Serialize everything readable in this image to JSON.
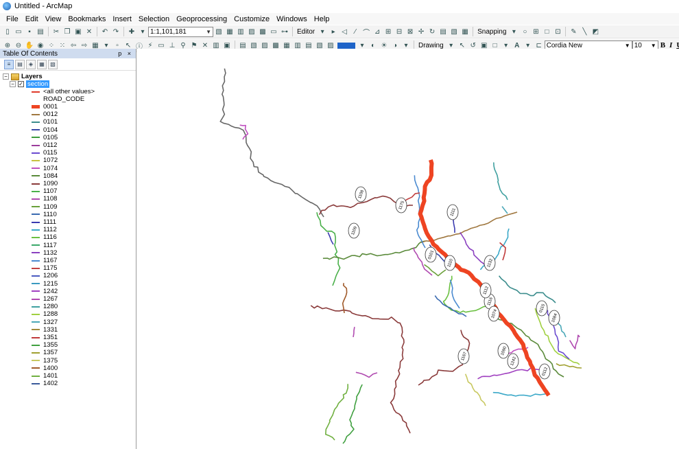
{
  "window": {
    "title": "Untitled - ArcMap"
  },
  "menu": [
    "File",
    "Edit",
    "View",
    "Bookmarks",
    "Insert",
    "Selection",
    "Geoprocessing",
    "Customize",
    "Windows",
    "Help"
  ],
  "toolbar": {
    "scale": "1:1,101,181",
    "editor_label": "Editor",
    "snapping_label": "Snapping",
    "drawing_label": "Drawing",
    "font_name": "Cordia New",
    "font_size": "10",
    "bold": "B",
    "italic": "I",
    "underline": "U",
    "font_color_glyph": "A"
  },
  "toc": {
    "title": "Table Of Contents",
    "controls": "p ×",
    "root_label": "Layers",
    "layer_name": "section",
    "other_values": "<all other values>",
    "field_name": "ROAD_CODE",
    "items": [
      {
        "code": "0001",
        "color": "#ee4422"
      },
      {
        "code": "0012",
        "color": "#a07840"
      },
      {
        "code": "0101",
        "color": "#3a8c8c"
      },
      {
        "code": "0104",
        "color": "#3a4aa8"
      },
      {
        "code": "0105",
        "color": "#3c9c3c"
      },
      {
        "code": "0112",
        "color": "#9c3c9c"
      },
      {
        "code": "0115",
        "color": "#6a4ad0"
      },
      {
        "code": "1072",
        "color": "#c8c040"
      },
      {
        "code": "1074",
        "color": "#c050c0"
      },
      {
        "code": "1084",
        "color": "#5a8a3a"
      },
      {
        "code": "1090",
        "color": "#8a3a3a"
      },
      {
        "code": "1107",
        "color": "#4ab04a"
      },
      {
        "code": "1108",
        "color": "#b04ab0"
      },
      {
        "code": "1109",
        "color": "#6aa03a"
      },
      {
        "code": "1110",
        "color": "#3a6ab0"
      },
      {
        "code": "1111",
        "color": "#3a3ab0"
      },
      {
        "code": "1112",
        "color": "#3aa8c8"
      },
      {
        "code": "1116",
        "color": "#6ac040"
      },
      {
        "code": "1117",
        "color": "#3aa86a"
      },
      {
        "code": "1132",
        "color": "#8a40c0"
      },
      {
        "code": "1167",
        "color": "#4a8ad0"
      },
      {
        "code": "1175",
        "color": "#c04040"
      },
      {
        "code": "1206",
        "color": "#4a5ac0"
      },
      {
        "code": "1215",
        "color": "#3a9ac0"
      },
      {
        "code": "1242",
        "color": "#a040c0"
      },
      {
        "code": "1267",
        "color": "#b04ab0"
      },
      {
        "code": "1280",
        "color": "#40a0a0"
      },
      {
        "code": "1288",
        "color": "#a0d040"
      },
      {
        "code": "1327",
        "color": "#4aa8b8"
      },
      {
        "code": "1331",
        "color": "#a08a3a"
      },
      {
        "code": "1351",
        "color": "#c03a3a"
      },
      {
        "code": "1355",
        "color": "#40a040"
      },
      {
        "code": "1357",
        "color": "#a0a030"
      },
      {
        "code": "1375",
        "color": "#c8c860"
      },
      {
        "code": "1400",
        "color": "#a05a2a"
      },
      {
        "code": "1401",
        "color": "#70b040"
      },
      {
        "code": "1402",
        "color": "#3a5a9a"
      }
    ]
  },
  "map": {
    "labels": [
      "1108",
      "1109",
      "0115",
      "1242",
      "0112",
      "1175",
      "1116",
      "1074",
      "1084",
      "1090",
      "1167",
      "1111",
      "1110",
      "1112",
      "0101",
      "1132"
    ]
  }
}
